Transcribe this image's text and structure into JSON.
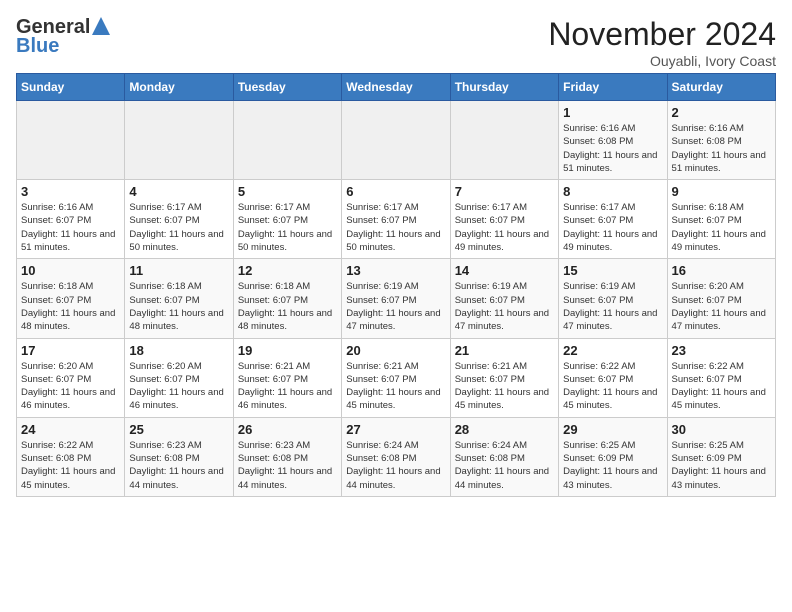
{
  "header": {
    "logo_general": "General",
    "logo_blue": "Blue",
    "month_title": "November 2024",
    "location": "Ouyabli, Ivory Coast"
  },
  "calendar": {
    "days_of_week": [
      "Sunday",
      "Monday",
      "Tuesday",
      "Wednesday",
      "Thursday",
      "Friday",
      "Saturday"
    ],
    "weeks": [
      [
        {
          "day": "",
          "info": ""
        },
        {
          "day": "",
          "info": ""
        },
        {
          "day": "",
          "info": ""
        },
        {
          "day": "",
          "info": ""
        },
        {
          "day": "",
          "info": ""
        },
        {
          "day": "1",
          "info": "Sunrise: 6:16 AM\nSunset: 6:08 PM\nDaylight: 11 hours and 51 minutes."
        },
        {
          "day": "2",
          "info": "Sunrise: 6:16 AM\nSunset: 6:08 PM\nDaylight: 11 hours and 51 minutes."
        }
      ],
      [
        {
          "day": "3",
          "info": "Sunrise: 6:16 AM\nSunset: 6:07 PM\nDaylight: 11 hours and 51 minutes."
        },
        {
          "day": "4",
          "info": "Sunrise: 6:17 AM\nSunset: 6:07 PM\nDaylight: 11 hours and 50 minutes."
        },
        {
          "day": "5",
          "info": "Sunrise: 6:17 AM\nSunset: 6:07 PM\nDaylight: 11 hours and 50 minutes."
        },
        {
          "day": "6",
          "info": "Sunrise: 6:17 AM\nSunset: 6:07 PM\nDaylight: 11 hours and 50 minutes."
        },
        {
          "day": "7",
          "info": "Sunrise: 6:17 AM\nSunset: 6:07 PM\nDaylight: 11 hours and 49 minutes."
        },
        {
          "day": "8",
          "info": "Sunrise: 6:17 AM\nSunset: 6:07 PM\nDaylight: 11 hours and 49 minutes."
        },
        {
          "day": "9",
          "info": "Sunrise: 6:18 AM\nSunset: 6:07 PM\nDaylight: 11 hours and 49 minutes."
        }
      ],
      [
        {
          "day": "10",
          "info": "Sunrise: 6:18 AM\nSunset: 6:07 PM\nDaylight: 11 hours and 48 minutes."
        },
        {
          "day": "11",
          "info": "Sunrise: 6:18 AM\nSunset: 6:07 PM\nDaylight: 11 hours and 48 minutes."
        },
        {
          "day": "12",
          "info": "Sunrise: 6:18 AM\nSunset: 6:07 PM\nDaylight: 11 hours and 48 minutes."
        },
        {
          "day": "13",
          "info": "Sunrise: 6:19 AM\nSunset: 6:07 PM\nDaylight: 11 hours and 47 minutes."
        },
        {
          "day": "14",
          "info": "Sunrise: 6:19 AM\nSunset: 6:07 PM\nDaylight: 11 hours and 47 minutes."
        },
        {
          "day": "15",
          "info": "Sunrise: 6:19 AM\nSunset: 6:07 PM\nDaylight: 11 hours and 47 minutes."
        },
        {
          "day": "16",
          "info": "Sunrise: 6:20 AM\nSunset: 6:07 PM\nDaylight: 11 hours and 47 minutes."
        }
      ],
      [
        {
          "day": "17",
          "info": "Sunrise: 6:20 AM\nSunset: 6:07 PM\nDaylight: 11 hours and 46 minutes."
        },
        {
          "day": "18",
          "info": "Sunrise: 6:20 AM\nSunset: 6:07 PM\nDaylight: 11 hours and 46 minutes."
        },
        {
          "day": "19",
          "info": "Sunrise: 6:21 AM\nSunset: 6:07 PM\nDaylight: 11 hours and 46 minutes."
        },
        {
          "day": "20",
          "info": "Sunrise: 6:21 AM\nSunset: 6:07 PM\nDaylight: 11 hours and 45 minutes."
        },
        {
          "day": "21",
          "info": "Sunrise: 6:21 AM\nSunset: 6:07 PM\nDaylight: 11 hours and 45 minutes."
        },
        {
          "day": "22",
          "info": "Sunrise: 6:22 AM\nSunset: 6:07 PM\nDaylight: 11 hours and 45 minutes."
        },
        {
          "day": "23",
          "info": "Sunrise: 6:22 AM\nSunset: 6:07 PM\nDaylight: 11 hours and 45 minutes."
        }
      ],
      [
        {
          "day": "24",
          "info": "Sunrise: 6:22 AM\nSunset: 6:08 PM\nDaylight: 11 hours and 45 minutes."
        },
        {
          "day": "25",
          "info": "Sunrise: 6:23 AM\nSunset: 6:08 PM\nDaylight: 11 hours and 44 minutes."
        },
        {
          "day": "26",
          "info": "Sunrise: 6:23 AM\nSunset: 6:08 PM\nDaylight: 11 hours and 44 minutes."
        },
        {
          "day": "27",
          "info": "Sunrise: 6:24 AM\nSunset: 6:08 PM\nDaylight: 11 hours and 44 minutes."
        },
        {
          "day": "28",
          "info": "Sunrise: 6:24 AM\nSunset: 6:08 PM\nDaylight: 11 hours and 44 minutes."
        },
        {
          "day": "29",
          "info": "Sunrise: 6:25 AM\nSunset: 6:09 PM\nDaylight: 11 hours and 43 minutes."
        },
        {
          "day": "30",
          "info": "Sunrise: 6:25 AM\nSunset: 6:09 PM\nDaylight: 11 hours and 43 minutes."
        }
      ]
    ]
  }
}
